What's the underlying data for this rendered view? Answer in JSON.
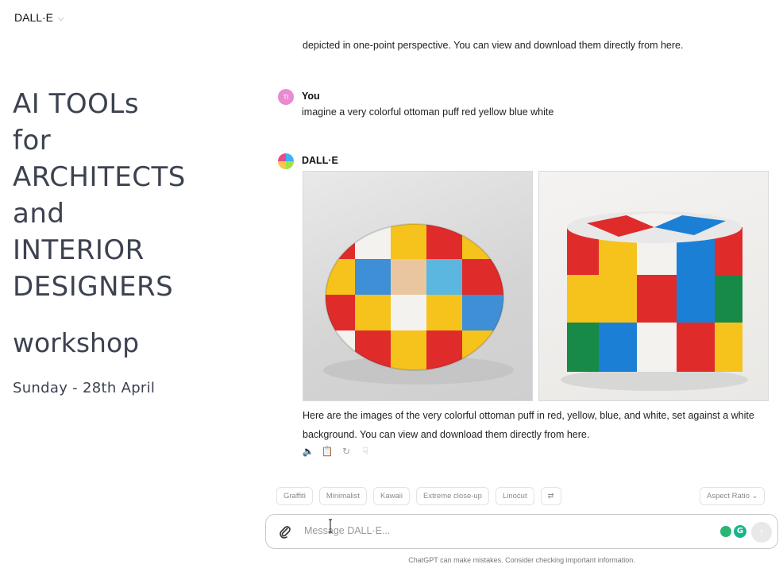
{
  "header": {
    "title": "DALL·E"
  },
  "overlay": {
    "title_lines": [
      "AI TOOLs",
      "for",
      "ARCHITECTS",
      "and",
      "INTERIOR",
      "DESIGNERS"
    ],
    "workshop": "workshop",
    "date": "Sunday - 28th April"
  },
  "chat": {
    "previous_text": "depicted in one-point perspective. You can view and download them directly from here.",
    "user": {
      "initials": "TI",
      "name": "You",
      "text": "imagine a very colorful ottoman puff red yellow blue white"
    },
    "assistant": {
      "name": "DALL·E",
      "images": [
        "ottoman-puff-round-patchwork",
        "ottoman-puff-cylinder-blocks"
      ],
      "response": "Here are the images of the very colorful ottoman puff in red, yellow, blue, and white, set against a white background. You can view and download them directly from here."
    }
  },
  "styles": [
    "Graffiti",
    "Minimalist",
    "Kawaii",
    "Extreme close-up",
    "Linocut"
  ],
  "aspect_ratio": "Aspect Ratio",
  "composer": {
    "placeholder": "Message DALL·E..."
  },
  "footer": "ChatGPT can make mistakes. Consider checking important information.",
  "colors": {
    "red": "#e02b2b",
    "yellow": "#f6c21c",
    "blue": "#1c7fd6",
    "green": "#168a46",
    "white": "#f4f2ee"
  }
}
